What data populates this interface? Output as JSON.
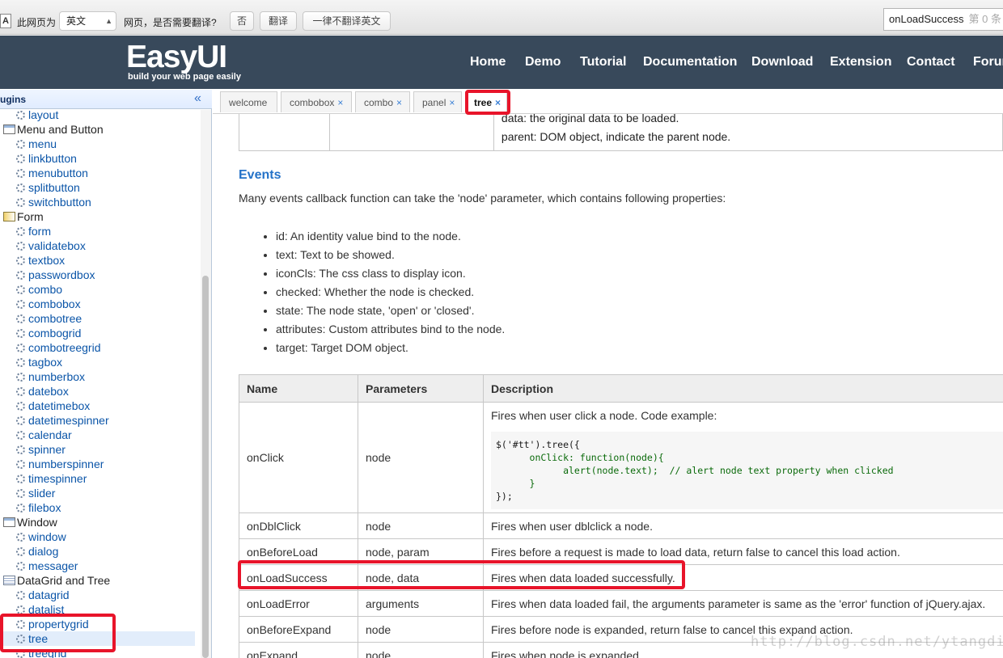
{
  "translate_bar": {
    "icon_letter": "A",
    "page_is": "此网页为",
    "language": "英文",
    "question": "网页，是否需要翻译?",
    "no": "否",
    "translate": "翻译",
    "never": "一律不翻译英文",
    "find_value": "onLoadSuccess",
    "find_count": "第 0 条"
  },
  "header": {
    "logo": "EasyUI",
    "tagline": "build your web page easily",
    "nav": [
      "Home",
      "Demo",
      "Tutorial",
      "Documentation",
      "Download",
      "Extension",
      "Contact",
      "Forum"
    ]
  },
  "sidebar": {
    "title": "ugins",
    "collapse": "«",
    "nodes": [
      {
        "label": "layout",
        "kind": "leaf"
      },
      {
        "label": "Menu and Button",
        "kind": "group",
        "icon": "window-icon"
      },
      {
        "label": "menu",
        "kind": "leaf"
      },
      {
        "label": "linkbutton",
        "kind": "leaf"
      },
      {
        "label": "menubutton",
        "kind": "leaf"
      },
      {
        "label": "splitbutton",
        "kind": "leaf"
      },
      {
        "label": "switchbutton",
        "kind": "leaf"
      },
      {
        "label": "Form",
        "kind": "group",
        "icon": "form-icon"
      },
      {
        "label": "form",
        "kind": "leaf"
      },
      {
        "label": "validatebox",
        "kind": "leaf"
      },
      {
        "label": "textbox",
        "kind": "leaf"
      },
      {
        "label": "passwordbox",
        "kind": "leaf"
      },
      {
        "label": "combo",
        "kind": "leaf"
      },
      {
        "label": "combobox",
        "kind": "leaf"
      },
      {
        "label": "combotree",
        "kind": "leaf"
      },
      {
        "label": "combogrid",
        "kind": "leaf"
      },
      {
        "label": "combotreegrid",
        "kind": "leaf"
      },
      {
        "label": "tagbox",
        "kind": "leaf"
      },
      {
        "label": "numberbox",
        "kind": "leaf"
      },
      {
        "label": "datebox",
        "kind": "leaf"
      },
      {
        "label": "datetimebox",
        "kind": "leaf"
      },
      {
        "label": "datetimespinner",
        "kind": "leaf"
      },
      {
        "label": "calendar",
        "kind": "leaf"
      },
      {
        "label": "spinner",
        "kind": "leaf"
      },
      {
        "label": "numberspinner",
        "kind": "leaf"
      },
      {
        "label": "timespinner",
        "kind": "leaf"
      },
      {
        "label": "slider",
        "kind": "leaf"
      },
      {
        "label": "filebox",
        "kind": "leaf"
      },
      {
        "label": "Window",
        "kind": "group",
        "icon": "window-icon"
      },
      {
        "label": "window",
        "kind": "leaf"
      },
      {
        "label": "dialog",
        "kind": "leaf"
      },
      {
        "label": "messager",
        "kind": "leaf"
      },
      {
        "label": "DataGrid and Tree",
        "kind": "group",
        "icon": "grid-icon"
      },
      {
        "label": "datagrid",
        "kind": "leaf"
      },
      {
        "label": "datalist",
        "kind": "leaf"
      },
      {
        "label": "propertygrid",
        "kind": "leaf"
      },
      {
        "label": "tree",
        "kind": "leaf"
      },
      {
        "label": "treegrid",
        "kind": "leaf"
      }
    ]
  },
  "tabs": [
    {
      "label": "welcome",
      "closable": false
    },
    {
      "label": "combobox",
      "closable": true
    },
    {
      "label": "combo",
      "closable": true
    },
    {
      "label": "panel",
      "closable": true
    },
    {
      "label": "tree",
      "closable": true,
      "active": true
    }
  ],
  "content": {
    "top_table_lines": [
      "data: the original data to be loaded.",
      "parent: DOM object, indicate the parent node."
    ],
    "events_heading": "Events",
    "intro": "Many events callback function can take the 'node' parameter, which contains following properties:",
    "properties": [
      "id: An identity value bind to the node.",
      "text: Text to be showed.",
      "iconCls: The css class to display icon.",
      "checked: Whether the node is checked.",
      "state: The node state, 'open' or 'closed'.",
      "attributes: Custom attributes bind to the node.",
      "target: Target DOM object."
    ],
    "table_headers": [
      "Name",
      "Parameters",
      "Description"
    ],
    "rows": [
      {
        "name": "onClick",
        "params": "node",
        "desc": "Fires when user click a node. Code example:"
      },
      {
        "name": "onDblClick",
        "params": "node",
        "desc": "Fires when user dblclick a node."
      },
      {
        "name": "onBeforeLoad",
        "params": "node, param",
        "desc": "Fires before a request is made to load data, return false to cancel this load action."
      },
      {
        "name": "onLoadSuccess",
        "params": "node, data",
        "desc": "Fires when data loaded successfully."
      },
      {
        "name": "onLoadError",
        "params": "arguments",
        "desc": "Fires when data loaded fail, the arguments parameter is same as the 'error' function of jQuery.ajax."
      },
      {
        "name": "onBeforeExpand",
        "params": "node",
        "desc": "Fires before node is expanded, return false to cancel this expand action."
      },
      {
        "name": "onExpand",
        "params": "node",
        "desc": "Fires when node is expanded."
      }
    ],
    "code_lines": [
      "$('#tt').tree({",
      "      onClick: function(node){",
      "            alert(node.text);  // alert node text property when clicked",
      "      }",
      "});"
    ]
  },
  "watermark": "http://blog.csdn.net/ytangdigl",
  "colors": {
    "header_bg": "#38495b",
    "link": "#0b55a8",
    "heading": "#2472c8",
    "highlight": "#e8142a"
  }
}
